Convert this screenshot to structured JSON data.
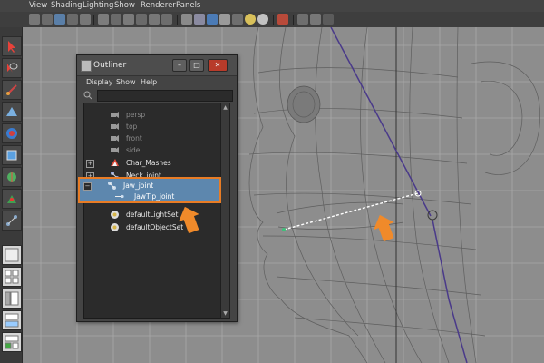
{
  "menubar": {
    "items": [
      "View",
      "Shading",
      "Lighting",
      "Show",
      "Renderer",
      "Panels"
    ]
  },
  "outliner": {
    "title": "Outliner",
    "menu": [
      "Display",
      "Show",
      "Help"
    ],
    "window_buttons": {
      "minimize": "–",
      "maximize": "□",
      "close": "✕"
    },
    "items": [
      {
        "label": "persp",
        "type": "camera",
        "dimmed": true
      },
      {
        "label": "top",
        "type": "camera",
        "dimmed": true
      },
      {
        "label": "front",
        "type": "camera",
        "dimmed": true
      },
      {
        "label": "side",
        "type": "camera",
        "dimmed": true
      },
      {
        "label": "Char_Mashes",
        "type": "mesh",
        "expander": "+"
      },
      {
        "label": "Neck_joint",
        "type": "joint",
        "expander": "+"
      },
      {
        "label": "Jaw_joint",
        "type": "joint",
        "expander": "−",
        "selected": true
      },
      {
        "label": "JawTip_joint",
        "type": "joint",
        "selected": true,
        "child": true
      },
      {
        "label": "defaultLightSet",
        "type": "set"
      },
      {
        "label": "defaultObjectSet",
        "type": "set"
      }
    ]
  },
  "colors": {
    "highlight": "#e87c25",
    "selection": "#5d87ae",
    "panel": "#444444"
  },
  "icons": {
    "camera": "camera-icon",
    "mesh": "mesh-icon",
    "joint": "joint-icon",
    "set": "set-icon"
  }
}
